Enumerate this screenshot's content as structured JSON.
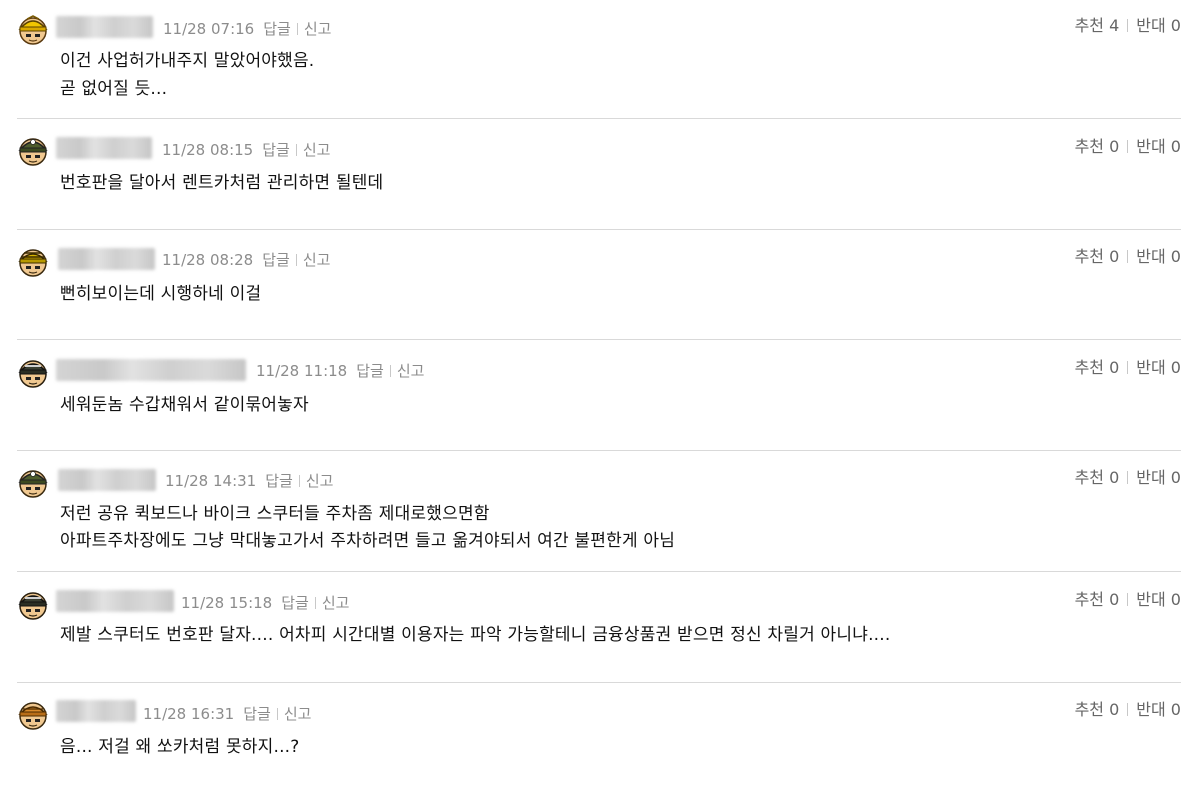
{
  "comments": [
    {
      "time": "11/28 07:16",
      "reply_label": "답글",
      "report_label": "신고",
      "upvote_label": "추천 4",
      "downvote_label": "반대 0",
      "lines": [
        "이건 사업허가내주지 말았어야했음.",
        "곧 없어질 듯..."
      ],
      "avatar_icon": "yellow-helmet-soldier-icon"
    },
    {
      "time": "11/28 08:15",
      "reply_label": "답글",
      "report_label": "신고",
      "upvote_label": "추천 0",
      "downvote_label": "반대 0",
      "lines": [
        "번호판을 달아서 렌트카처럼 관리하면 될텐데"
      ],
      "avatar_icon": "green-helmet-soldier-icon"
    },
    {
      "time": "11/28 08:28",
      "reply_label": "답글",
      "report_label": "신고",
      "upvote_label": "추천 0",
      "downvote_label": "반대 0",
      "lines": [
        "뻔히보이는데 시행하네 이걸"
      ],
      "avatar_icon": "striped-cap-soldier-icon"
    },
    {
      "time": "11/28 11:18",
      "reply_label": "답글",
      "report_label": "신고",
      "upvote_label": "추천 0",
      "downvote_label": "반대 0",
      "lines": [
        "세워둔놈 수갑채워서 같이묶어놓자"
      ],
      "avatar_icon": "dark-helmet-soldier-icon"
    },
    {
      "time": "11/28 14:31",
      "reply_label": "답글",
      "report_label": "신고",
      "upvote_label": "추천 0",
      "downvote_label": "반대 0",
      "lines": [
        "저런 공유 퀵보드나 바이크 스쿠터들 주차좀 제대로했으면함",
        "아파트주차장에도 그냥 막대놓고가서 주차하려면 들고 옮겨야되서 여간 불편한게 아님"
      ],
      "avatar_icon": "green-helmet-soldier-icon"
    },
    {
      "time": "11/28 15:18",
      "reply_label": "답글",
      "report_label": "신고",
      "upvote_label": "추천 0",
      "downvote_label": "반대 0",
      "lines": [
        "제발 스쿠터도 번호판 달자.... 어차피 시간대별 이용자는 파악 가능할테니 금융상품권 받으면 정신 차릴거 아니냐...."
      ],
      "avatar_icon": "dark-helmet-soldier-icon"
    },
    {
      "time": "11/28 16:31",
      "reply_label": "답글",
      "report_label": "신고",
      "upvote_label": "추천 0",
      "downvote_label": "반대 0",
      "lines": [
        "음... 저걸 왜 쏘카처럼 못하지...?"
      ],
      "avatar_icon": "orange-cap-soldier-icon"
    }
  ],
  "colors": {
    "meta_text": "#8c8c8c",
    "vote_text": "#666666",
    "divider": "#d9d9d9",
    "body_text": "#111111"
  }
}
